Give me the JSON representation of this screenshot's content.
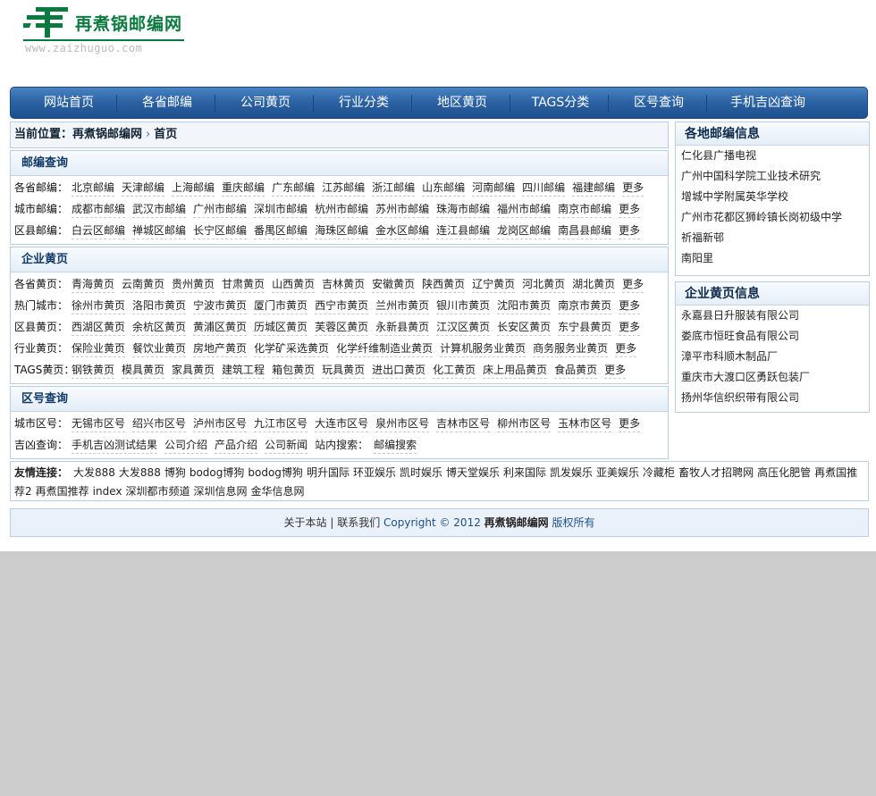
{
  "logo": {
    "name": "再煮锅邮编网",
    "url": "www.zaizhuguo.com",
    "brand_color": "#0b7a3e"
  },
  "nav": [
    "网站首页",
    "各省邮编",
    "公司黄页",
    "行业分类",
    "地区黄页",
    "TAGS分类",
    "区号查询",
    "手机吉凶查询"
  ],
  "breadcrumb": {
    "label": "当前位置：",
    "site": "再煮锅邮编网",
    "current": "首页"
  },
  "postcode": {
    "title": "邮编查询",
    "rows": [
      {
        "label": "各省邮编：",
        "links": [
          "北京邮编",
          "天津邮编",
          "上海邮编",
          "重庆邮编",
          "广东邮编",
          "江苏邮编",
          "浙江邮编",
          "山东邮编",
          "河南邮编",
          "四川邮编",
          "福建邮编",
          "更多"
        ]
      },
      {
        "label": "城市邮编：",
        "links": [
          "成都市邮编",
          "武汉市邮编",
          "广州市邮编",
          "深圳市邮编",
          "杭州市邮编",
          "苏州市邮编",
          "珠海市邮编",
          "福州市邮编",
          "南京市邮编",
          "更多"
        ]
      },
      {
        "label": "区县邮编：",
        "links": [
          "白云区邮编",
          "禅城区邮编",
          "长宁区邮编",
          "番禺区邮编",
          "海珠区邮编",
          "金水区邮编",
          "连江县邮编",
          "龙岗区邮编",
          "南昌县邮编",
          "更多"
        ]
      }
    ]
  },
  "yellowpages": {
    "title": "企业黄页",
    "rows": [
      {
        "label": "各省黄页：",
        "links": [
          "青海黄页",
          "云南黄页",
          "贵州黄页",
          "甘肃黄页",
          "山西黄页",
          "吉林黄页",
          "安徽黄页",
          "陕西黄页",
          "辽宁黄页",
          "河北黄页",
          "湖北黄页",
          "更多"
        ]
      },
      {
        "label": "热门城市：",
        "links": [
          "徐州市黄页",
          "洛阳市黄页",
          "宁波市黄页",
          "厦门市黄页",
          "西宁市黄页",
          "兰州市黄页",
          "银川市黄页",
          "沈阳市黄页",
          "南京市黄页",
          "更多"
        ]
      },
      {
        "label": "区县黄页：",
        "links": [
          "西湖区黄页",
          "余杭区黄页",
          "黄浦区黄页",
          "历城区黄页",
          "芙蓉区黄页",
          "永新县黄页",
          "江汉区黄页",
          "长安区黄页",
          "东宁县黄页",
          "更多"
        ]
      },
      {
        "label": "行业黄页：",
        "links": [
          "保险业黄页",
          "餐饮业黄页",
          "房地产黄页",
          "化学矿采选黄页",
          "化学纤维制造业黄页",
          "计算机服务业黄页",
          "商务服务业黄页",
          "更多"
        ]
      },
      {
        "label": "TAGS黄页：",
        "links": [
          "钢铁黄页",
          "模具黄页",
          "家具黄页",
          "建筑工程",
          "箱包黄页",
          "玩具黄页",
          "进出口黄页",
          "化工黄页",
          "床上用品黄页",
          "食品黄页",
          "更多"
        ]
      }
    ]
  },
  "areacode": {
    "title": "区号查询",
    "rows": [
      {
        "label": "城市区号：",
        "links": [
          "无锡市区号",
          "绍兴市区号",
          "泸州市区号",
          "九江市区号",
          "大连市区号",
          "泉州市区号",
          "吉林市区号",
          "柳州市区号",
          "玉林市区号",
          "更多"
        ]
      },
      {
        "label": "吉凶查询：",
        "links": [
          "手机吉凶测试结果",
          "公司介绍",
          "产品介绍",
          "公司新闻"
        ],
        "extra_label": "站内搜索：",
        "extra_links": [
          "邮编搜索"
        ]
      }
    ]
  },
  "side_postcode": {
    "title": "各地邮编信息",
    "items": [
      "仁化县广播电视",
      "广州中国科学院工业技术研究",
      "增城中学附属英华学校",
      "广州市花都区狮岭镇长岗初级中学",
      "祈福新邨",
      "南阳里"
    ]
  },
  "side_company": {
    "title": "企业黄页信息",
    "items": [
      "永嘉县日升服装有限公司",
      "娄底市恒旺食品有限公司",
      "漳平市科顺木制品厂",
      "重庆市大渡口区勇跃包装厂",
      "扬州华信织织带有限公司"
    ]
  },
  "friend_links": {
    "title": "友情连接：",
    "items": [
      "大发888",
      "大发888",
      "博狗",
      "bodog博狗",
      "bodog博狗",
      "明升国际",
      "环亚娱乐",
      "凯时娱乐",
      "博天堂娱乐",
      "利来国际",
      "凯发娱乐",
      "亚美娱乐",
      "冷藏柜",
      "畜牧人才招聘网",
      "高压化肥管",
      "再煮国推荐2",
      "再煮国推荐",
      "index",
      "深圳都市频道",
      "深圳信息网",
      "金华信息网"
    ]
  },
  "footer": {
    "about": "关于本站",
    "sep": "|",
    "contact": "联系我们",
    "copyright": "Copyright © 2012",
    "site": "再煮锅邮编网",
    "rights": "版权所有"
  }
}
